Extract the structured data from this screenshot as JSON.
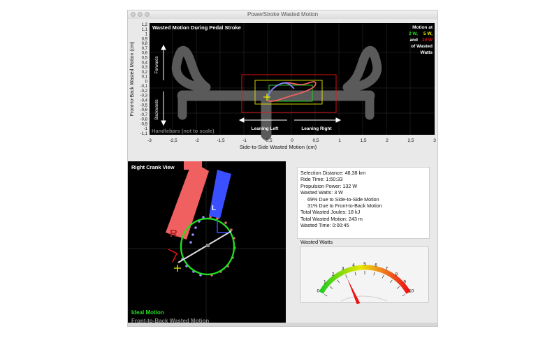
{
  "window": {
    "title": "PowerStroke Wasted Motion"
  },
  "top_plot": {
    "title": "Wasted Motion During Pedal Stroke",
    "ylabel": "Front-to-Back Wasted Motion (cm)",
    "xlabel": "Side-to-Side Wasted Motion (cm)",
    "x_ticks": [
      "-3",
      "-2,5",
      "-2",
      "-1,5",
      "-1",
      "-0,5",
      "0",
      "0,5",
      "1",
      "1,5",
      "2",
      "2,5",
      "3"
    ],
    "y_ticks": [
      "1,2",
      "1,1",
      "1",
      "0,9",
      "0,8",
      "0,7",
      "0,6",
      "0,5",
      "0,4",
      "0,3",
      "0,2",
      "0,1",
      "0",
      "-0,1",
      "-0,2",
      "-0,3",
      "-0,4",
      "-0,5",
      "-0,6",
      "-0,7",
      "-0,8",
      "-0,9",
      "-1",
      "-1,1"
    ],
    "forwards_label": "Forwards",
    "backwards_label": "Backwards",
    "leaning_left": "Leaning Left",
    "leaning_right": "Leaning Right",
    "handlebars_label": "Handlebars (not to scale)",
    "legend": {
      "line1": "Motion at",
      "w2": "2 W,",
      "w5": "5 W,",
      "and": "and",
      "w10": "10 W",
      "line3": "of Wasted",
      "line4": "Watts"
    },
    "colors": {
      "w2": "#22dd22",
      "w5": "#e8e800",
      "w10": "#ee1111",
      "handlebar": "#5a5a5a"
    }
  },
  "crank_view": {
    "title": "Right Crank View",
    "r_label": "R",
    "l_label": "L",
    "ideal_label": "Ideal Motion",
    "wasted_label": "Front-to-Back Wasted Motion",
    "colors": {
      "ideal": "#22dd22",
      "right_arm": "#f06060",
      "left_arm": "#3a4fff",
      "wasted": "#888888"
    }
  },
  "stats": {
    "selection_distance": "Selection Distance: 48,38 km",
    "ride_time": "Ride Time: 1:50:33",
    "propulsion_power": "Propulsion Power: 132 W",
    "wasted_watts": "Wasted Watts: 3 W",
    "side_to_side": "69% Due to Side-to-Side Motion",
    "front_to_back": "31% Due to Front-to-Back Motion",
    "total_joules": "Total Wasted Joules: 18 kJ",
    "total_motion": "Total Wasted Motion: 243 m",
    "wasted_time": "Wasted Time: 0:00:45"
  },
  "gauge": {
    "label": "Wasted Watts",
    "ticks": [
      "0",
      "1",
      "2",
      "3",
      "4",
      "5",
      "6",
      "7",
      "8",
      "9",
      "10"
    ],
    "value": 3,
    "min": 0,
    "max": 10
  }
}
